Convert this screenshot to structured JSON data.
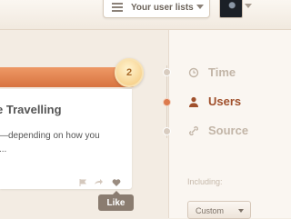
{
  "header": {
    "lists_button_label": "Your user lists"
  },
  "badge": {
    "count": "2"
  },
  "card": {
    "title": "e Travelling",
    "text": "—depending on how you ..."
  },
  "tooltip": {
    "label": "Like"
  },
  "sidebar": {
    "items": [
      {
        "label": "Time",
        "icon": "clock-icon",
        "active": false
      },
      {
        "label": "Users",
        "icon": "user-icon",
        "active": true
      },
      {
        "label": "Source",
        "icon": "link-icon",
        "active": false
      }
    ],
    "including_label": "Including:",
    "filter_value": "Custom"
  },
  "colors": {
    "accent": "#dc7a4d",
    "active_text": "#a0502c",
    "inactive_text": "#c2b5a7",
    "tooltip_bg": "#8a7c70"
  }
}
